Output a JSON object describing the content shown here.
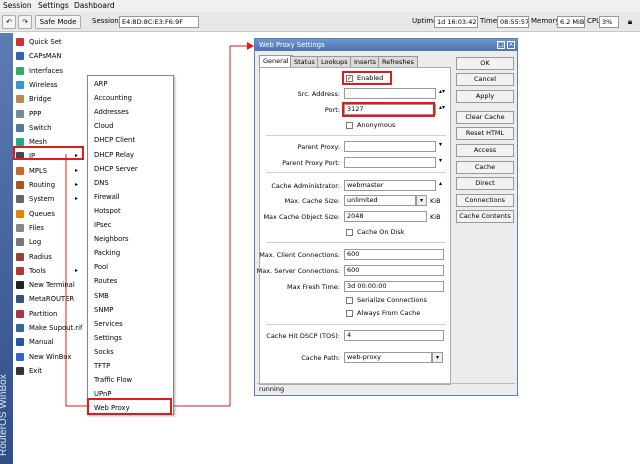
{
  "menubar": {
    "items": [
      "Session",
      "Settings",
      "Dashboard"
    ]
  },
  "toolbar": {
    "undo_icon": "undo-icon",
    "redo_icon": "redo-icon",
    "safe_mode": "Safe Mode",
    "session_label": "Session:",
    "session_value": "E4:8D:8C:E3:F6:9F",
    "uptime_label": "Uptime",
    "uptime_value": "1d 16:03:42",
    "time_label": "Time",
    "time_value": "08:55:57",
    "memory_label": "Memory",
    "memory_value": "6.2 MiB",
    "cpu_label": "CPU",
    "cpu_value": "3%"
  },
  "sidebar": {
    "brand": "RouterOS WinBox",
    "items": [
      {
        "label": "Quick Set",
        "arrow": ""
      },
      {
        "label": "CAPsMAN",
        "arrow": ""
      },
      {
        "label": "Interfaces",
        "arrow": ""
      },
      {
        "label": "Wireless",
        "arrow": ""
      },
      {
        "label": "Bridge",
        "arrow": ""
      },
      {
        "label": "PPP",
        "arrow": ""
      },
      {
        "label": "Switch",
        "arrow": ""
      },
      {
        "label": "Mesh",
        "arrow": ""
      },
      {
        "label": "IP",
        "arrow": "▸"
      },
      {
        "label": "MPLS",
        "arrow": "▸"
      },
      {
        "label": "Routing",
        "arrow": "▸"
      },
      {
        "label": "System",
        "arrow": "▸"
      },
      {
        "label": "Queues",
        "arrow": ""
      },
      {
        "label": "Files",
        "arrow": ""
      },
      {
        "label": "Log",
        "arrow": ""
      },
      {
        "label": "Radius",
        "arrow": ""
      },
      {
        "label": "Tools",
        "arrow": "▸"
      },
      {
        "label": "New Terminal",
        "arrow": ""
      },
      {
        "label": "MetaROUTER",
        "arrow": ""
      },
      {
        "label": "Partition",
        "arrow": ""
      },
      {
        "label": "Make Supout.rif",
        "arrow": ""
      },
      {
        "label": "Manual",
        "arrow": ""
      },
      {
        "label": "New WinBox",
        "arrow": ""
      },
      {
        "label": "Exit",
        "arrow": ""
      }
    ]
  },
  "submenu": {
    "items": [
      "ARP",
      "Accounting",
      "Addresses",
      "Cloud",
      "DHCP Client",
      "DHCP Relay",
      "DHCP Server",
      "DNS",
      "Firewall",
      "Hotspot",
      "IPsec",
      "Neighbors",
      "Packing",
      "Pool",
      "Routes",
      "SMB",
      "SNMP",
      "Services",
      "Settings",
      "Socks",
      "TFTP",
      "Traffic Flow",
      "UPnP",
      "Web Proxy"
    ]
  },
  "window": {
    "title": "Web Proxy Settings",
    "tabs": [
      "General",
      "Status",
      "Lookups",
      "Inserts",
      "Refreshes"
    ],
    "enabled_label": "Enabled",
    "enabled_checked": true,
    "src_address_label": "Src. Address:",
    "src_address_value": "::",
    "port_label": "Port:",
    "port_value": "3127",
    "anonymous_label": "Anonymous",
    "anonymous_checked": false,
    "parent_proxy_label": "Parent Proxy:",
    "parent_proxy_value": "",
    "parent_proxy_port_label": "Parent Proxy Port:",
    "parent_proxy_port_value": "",
    "cache_admin_label": "Cache Administrator:",
    "cache_admin_value": "webmaster",
    "max_cache_size_label": "Max. Cache Size:",
    "max_cache_size_value": "unlimited",
    "max_cache_size_unit": "KiB",
    "max_cache_object_label": "Max Cache Object Size:",
    "max_cache_object_value": "2048",
    "max_cache_object_unit": "KiB",
    "cache_on_disk_label": "Cache On Disk",
    "cache_on_disk_checked": false,
    "max_client_label": "Max. Client Connections:",
    "max_client_value": "600",
    "max_server_label": "Max. Server Connections:",
    "max_server_value": "600",
    "max_fresh_label": "Max Fresh Time:",
    "max_fresh_value": "3d 00:00:00",
    "serialize_label": "Serialize Connections",
    "serialize_checked": false,
    "always_cache_label": "Always From Cache",
    "always_cache_checked": false,
    "dscp_label": "Cache Hit DSCP (TOS):",
    "dscp_value": "4",
    "cache_path_label": "Cache Path:",
    "cache_path_value": "web-proxy",
    "buttons": [
      "OK",
      "Cancel",
      "Apply",
      "Clear Cache",
      "Reset HTML",
      "Access",
      "Cache",
      "Direct",
      "Connections",
      "Cache Contents"
    ],
    "status": "running"
  },
  "colors": {
    "highlight": "#e11a1a",
    "titlebar": "#4b73b0",
    "sidebar_strip": "#3a5a94"
  }
}
